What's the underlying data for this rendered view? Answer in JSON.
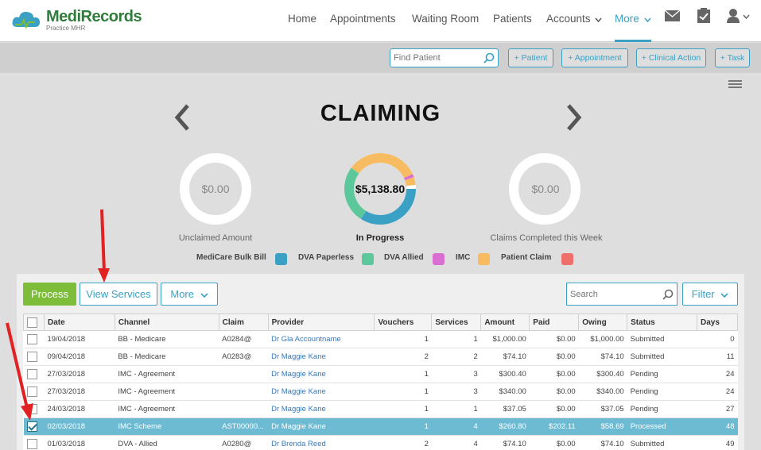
{
  "brand": {
    "name": "MediRecords",
    "subtitle": "Practice MHR"
  },
  "nav": {
    "items": [
      "Home",
      "Appointments",
      "Waiting Room",
      "Patients",
      "Accounts",
      "More"
    ]
  },
  "actionbar": {
    "find_placeholder": "Find Patient",
    "buttons": [
      "+ Patient",
      "+ Appointment",
      "+ Clinical Action",
      "+ Task"
    ]
  },
  "page": {
    "title": "CLAIMING"
  },
  "summary": {
    "unclaimed_value": "$0.00",
    "unclaimed_label": "Unclaimed Amount",
    "inprogress_value": "$5,138.80",
    "inprogress_label": "In Progress",
    "completed_value": "$0.00",
    "completed_label": "Claims Completed this Week"
  },
  "legend": [
    {
      "label": "MediCare Bulk Bill",
      "color": "#3aa0c4"
    },
    {
      "label": "DVA Paperless",
      "color": "#5cc79a"
    },
    {
      "label": "DVA Allied",
      "color": "#d96fd0"
    },
    {
      "label": "IMC",
      "color": "#f7bc62"
    },
    {
      "label": "Patient Claim",
      "color": "#ef6f6a"
    }
  ],
  "toolbar": {
    "process": "Process",
    "view_services": "View Services",
    "more": "More",
    "search_placeholder": "Search",
    "filter": "Filter"
  },
  "table": {
    "headers": [
      "Date",
      "Channel",
      "Claim",
      "Provider",
      "Vouchers",
      "Services",
      "Amount",
      "Paid",
      "Owing",
      "Status",
      "Days"
    ],
    "rows": [
      [
        "19/04/2018",
        "BB - Medicare",
        "A0284@",
        "Dr Gla Accountname",
        "1",
        "1",
        "$1,000.00",
        "$0.00",
        "$1,000.00",
        "Submitted",
        "0"
      ],
      [
        "09/04/2018",
        "BB - Medicare",
        "A0283@",
        "Dr Maggie Kane",
        "2",
        "2",
        "$74.10",
        "$0.00",
        "$74.10",
        "Submitted",
        "11"
      ],
      [
        "27/03/2018",
        "IMC - Agreement",
        "",
        "Dr Maggie Kane",
        "1",
        "3",
        "$300.40",
        "$0.00",
        "$300.40",
        "Pending",
        "24"
      ],
      [
        "27/03/2018",
        "IMC - Agreement",
        "",
        "Dr Maggie Kane",
        "1",
        "3",
        "$340.00",
        "$0.00",
        "$340.00",
        "Pending",
        "24"
      ],
      [
        "24/03/2018",
        "IMC - Agreement",
        "",
        "Dr Maggie Kane",
        "1",
        "1",
        "$37.05",
        "$0.00",
        "$37.05",
        "Pending",
        "27"
      ],
      [
        "02/03/2018",
        "IMC Scheme",
        "AST00000...",
        "Dr Maggie Kane",
        "1",
        "4",
        "$260.80",
        "$202.11",
        "$58.69",
        "Processed",
        "48"
      ],
      [
        "01/03/2018",
        "DVA - Allied",
        "A0280@",
        "Dr Brenda Reed",
        "2",
        "4",
        "$74.10",
        "$0.00",
        "$74.10",
        "Submitted",
        "49"
      ]
    ],
    "selected_row": 5
  },
  "donut_inprogress": [
    {
      "name": "MediCare Bulk Bill",
      "color": "#3aa0c4",
      "fraction": 0.36
    },
    {
      "name": "DVA Paperless",
      "color": "#5cc79a",
      "fraction": 0.26
    },
    {
      "name": "IMC",
      "color": "#f7bc62",
      "fraction": 0.33
    },
    {
      "name": "DVA Allied",
      "color": "#d96fd0",
      "fraction": 0.015
    },
    {
      "name": "IMC",
      "color": "#f7bc62",
      "fraction": 0.035
    }
  ]
}
